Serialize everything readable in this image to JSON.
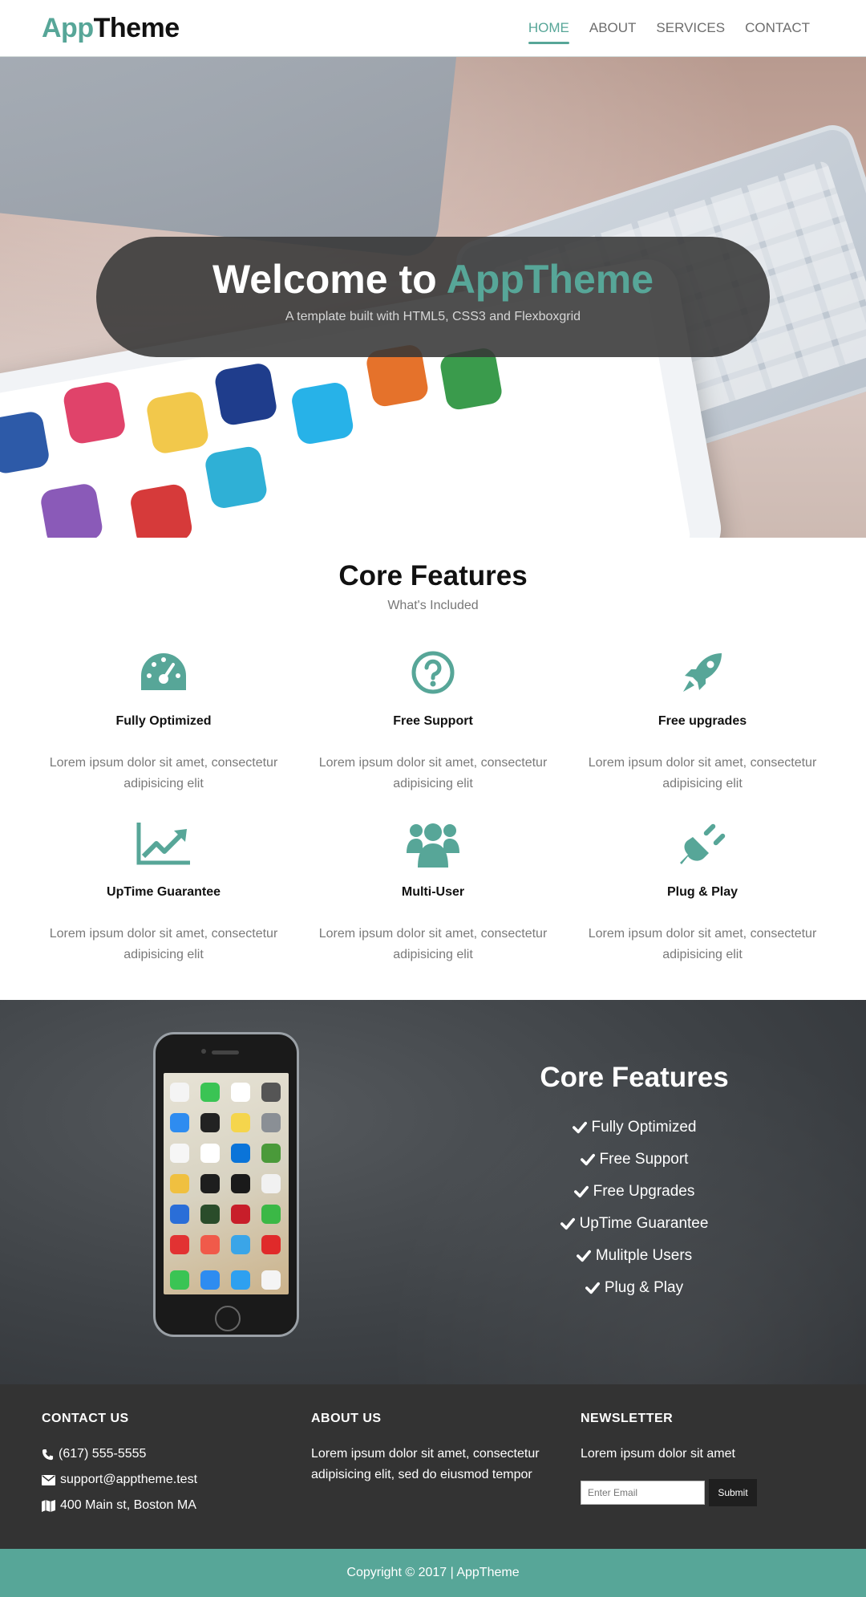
{
  "header": {
    "logo_accent": "App",
    "logo_main": "Theme",
    "nav": [
      "HOME",
      "ABOUT",
      "SERVICES",
      "CONTACT"
    ],
    "active_nav": "HOME",
    "accent_color": "#57a698"
  },
  "hero": {
    "title_prefix": "Welcome to ",
    "title_accent": "AppTheme",
    "subtitle": "A template built with HTML5, CSS3 and Flexboxgrid"
  },
  "features": {
    "title": "Core Features",
    "subtitle": "What's Included",
    "items": [
      {
        "icon": "dashboard-icon",
        "title": "Fully Optimized",
        "text": "Lorem ipsum dolor sit amet, consectetur adipisicing elit"
      },
      {
        "icon": "question-circle-icon",
        "title": "Free Support",
        "text": "Lorem ipsum dolor sit amet, consectetur adipisicing elit"
      },
      {
        "icon": "rocket-icon",
        "title": "Free upgrades",
        "text": "Lorem ipsum dolor sit amet, consectetur adipisicing elit"
      },
      {
        "icon": "line-chart-icon",
        "title": "UpTime Guarantee",
        "text": "Lorem ipsum dolor sit amet, consectetur adipisicing elit"
      },
      {
        "icon": "users-icon",
        "title": "Multi-User",
        "text": "Lorem ipsum dolor sit amet, consectetur adipisicing elit"
      },
      {
        "icon": "plug-icon",
        "title": "Plug & Play",
        "text": "Lorem ipsum dolor sit amet, consectetur adipisicing elit"
      }
    ]
  },
  "showcase": {
    "title": "Core Features",
    "items": [
      "Fully Optimized",
      "Free Support",
      "Free Upgrades",
      "UpTime Guarantee",
      "Mulitple Users",
      "Plug & Play"
    ]
  },
  "footer": {
    "contact": {
      "heading": "CONTACT US",
      "phone": "(617) 555-5555",
      "email": "support@apptheme.test",
      "address": "400 Main st, Boston MA"
    },
    "about": {
      "heading": "ABOUT US",
      "text": "Lorem ipsum dolor sit amet, consectetur adipisicing elit, sed do eiusmod tempor"
    },
    "newsletter": {
      "heading": "NEWSLETTER",
      "text": "Lorem ipsum dolor sit amet",
      "placeholder": "Enter Email",
      "button": "Submit"
    },
    "copyright": "Copyright © 2017 | AppTheme"
  }
}
